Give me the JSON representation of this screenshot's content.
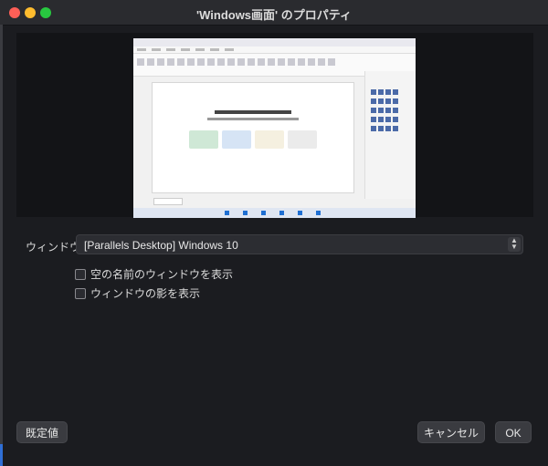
{
  "window": {
    "title": "'Windows画面' のプロパティ"
  },
  "preview": {},
  "form": {
    "window_label": "ウィンドウ",
    "window_value": "[Parallels Desktop] Windows 10",
    "checkbox_empty_title": "空の名前のウィンドウを表示",
    "checkbox_shadow": "ウィンドウの影を表示"
  },
  "buttons": {
    "defaults": "既定値",
    "cancel": "キャンセル",
    "ok": "OK"
  },
  "colors": {
    "background": "#1b1c20",
    "preview_bg": "#131417",
    "button": "#3a3b40"
  }
}
